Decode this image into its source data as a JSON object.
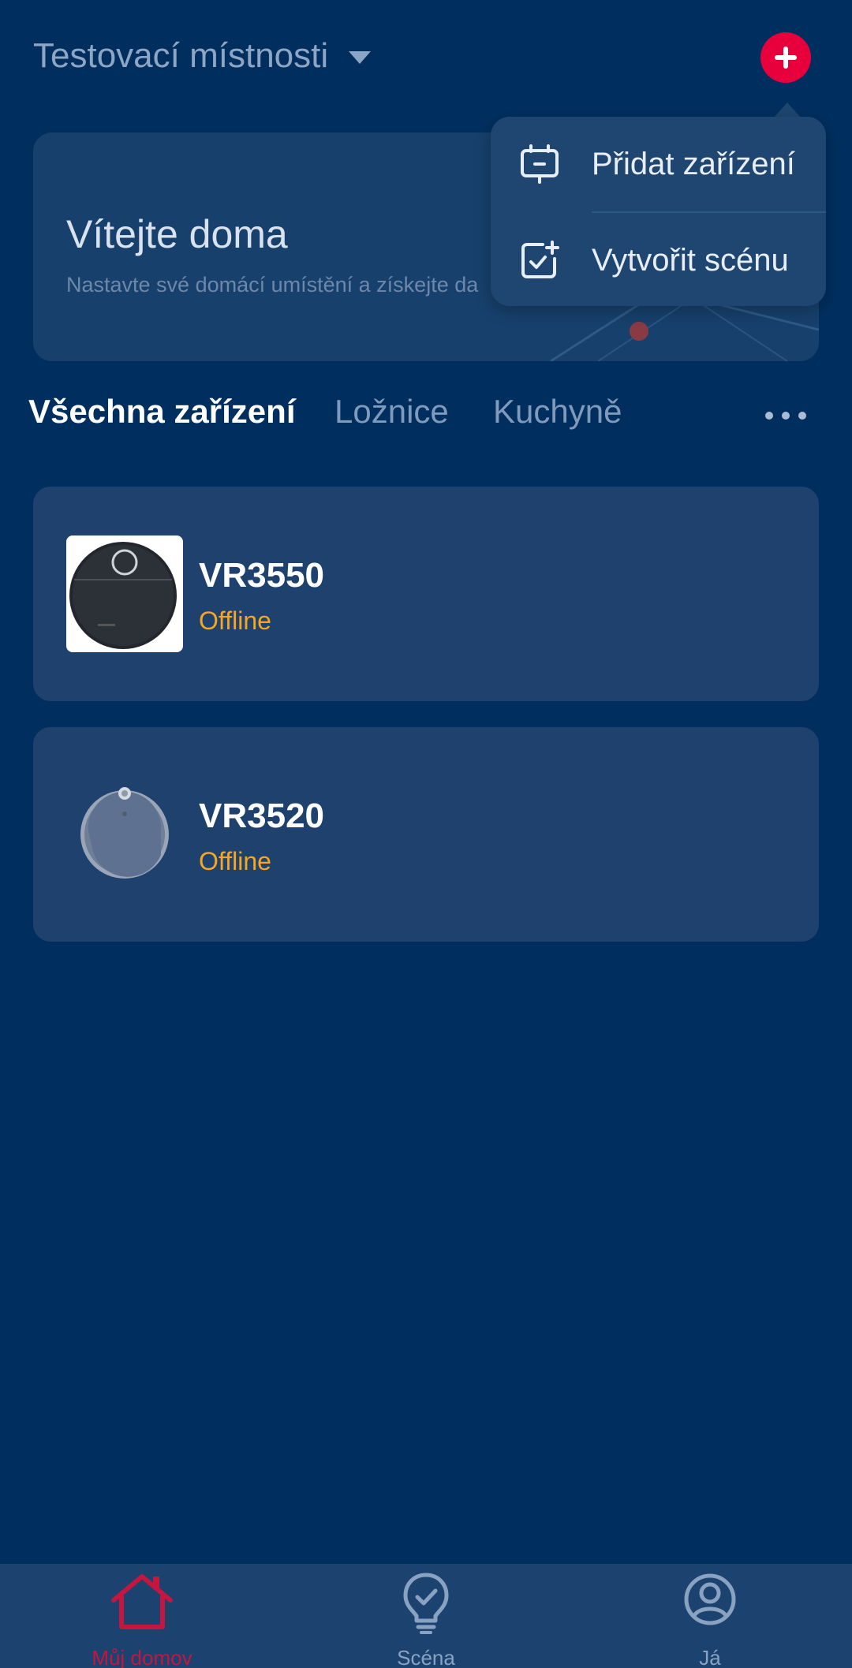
{
  "header": {
    "home_name": "Testovací místnosti",
    "add_icon": "plus-circle-icon",
    "accent_color": "#e8003d"
  },
  "banner": {
    "title": "Vítejte doma",
    "subtitle": "Nastavte své domácí umístění a získejte da"
  },
  "menu": {
    "items": [
      {
        "label": "Přidat zařízení",
        "icon": "add-device-icon"
      },
      {
        "label": "Vytvořit scénu",
        "icon": "create-scene-icon"
      }
    ]
  },
  "tabs": {
    "items": [
      {
        "label": "Všechna zařízení",
        "active": true
      },
      {
        "label": "Ložnice",
        "active": false
      },
      {
        "label": "Kuchyně",
        "active": false
      }
    ],
    "more_icon": "more-horizontal-icon"
  },
  "devices": [
    {
      "name": "VR3550",
      "status": "Offline"
    },
    {
      "name": "VR3520",
      "status": "Offline"
    }
  ],
  "status_color": "#f5a623",
  "bottom_nav": {
    "items": [
      {
        "label": "Můj domov",
        "icon": "home-icon",
        "active": true
      },
      {
        "label": "Scéna",
        "icon": "lightbulb-icon",
        "active": false
      },
      {
        "label": "Já",
        "icon": "profile-icon",
        "active": false
      }
    ]
  }
}
